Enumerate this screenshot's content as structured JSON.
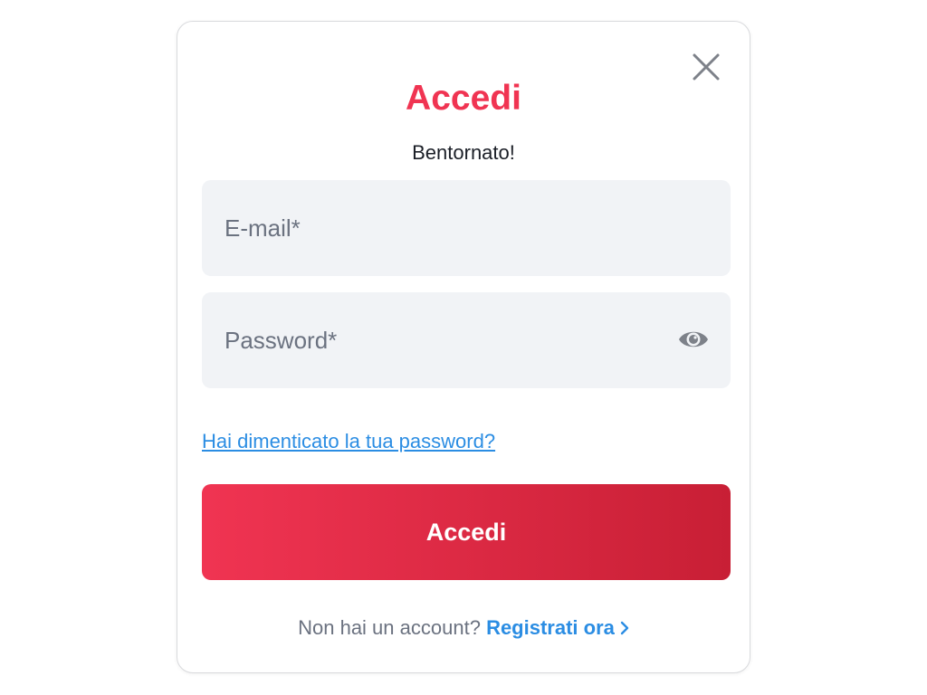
{
  "colors": {
    "accent": "#f03452",
    "accent_dark": "#c81f35",
    "link": "#2b8de3",
    "muted": "#6b7280",
    "field_bg": "#f1f3f6",
    "icon": "#7d8189"
  },
  "login": {
    "title": "Accedi",
    "subtitle": "Bentornato!",
    "email_placeholder": "E-mail*",
    "password_placeholder": "Password*",
    "forgot_link": "Hai dimenticato la tua password?",
    "submit_label": "Accedi",
    "footer_text": "Non hai un account?",
    "register_link": "Registrati ora",
    "icons": {
      "close": "close-icon",
      "password_toggle": "eye-icon",
      "register_arrow": "chevron-right-icon"
    }
  }
}
